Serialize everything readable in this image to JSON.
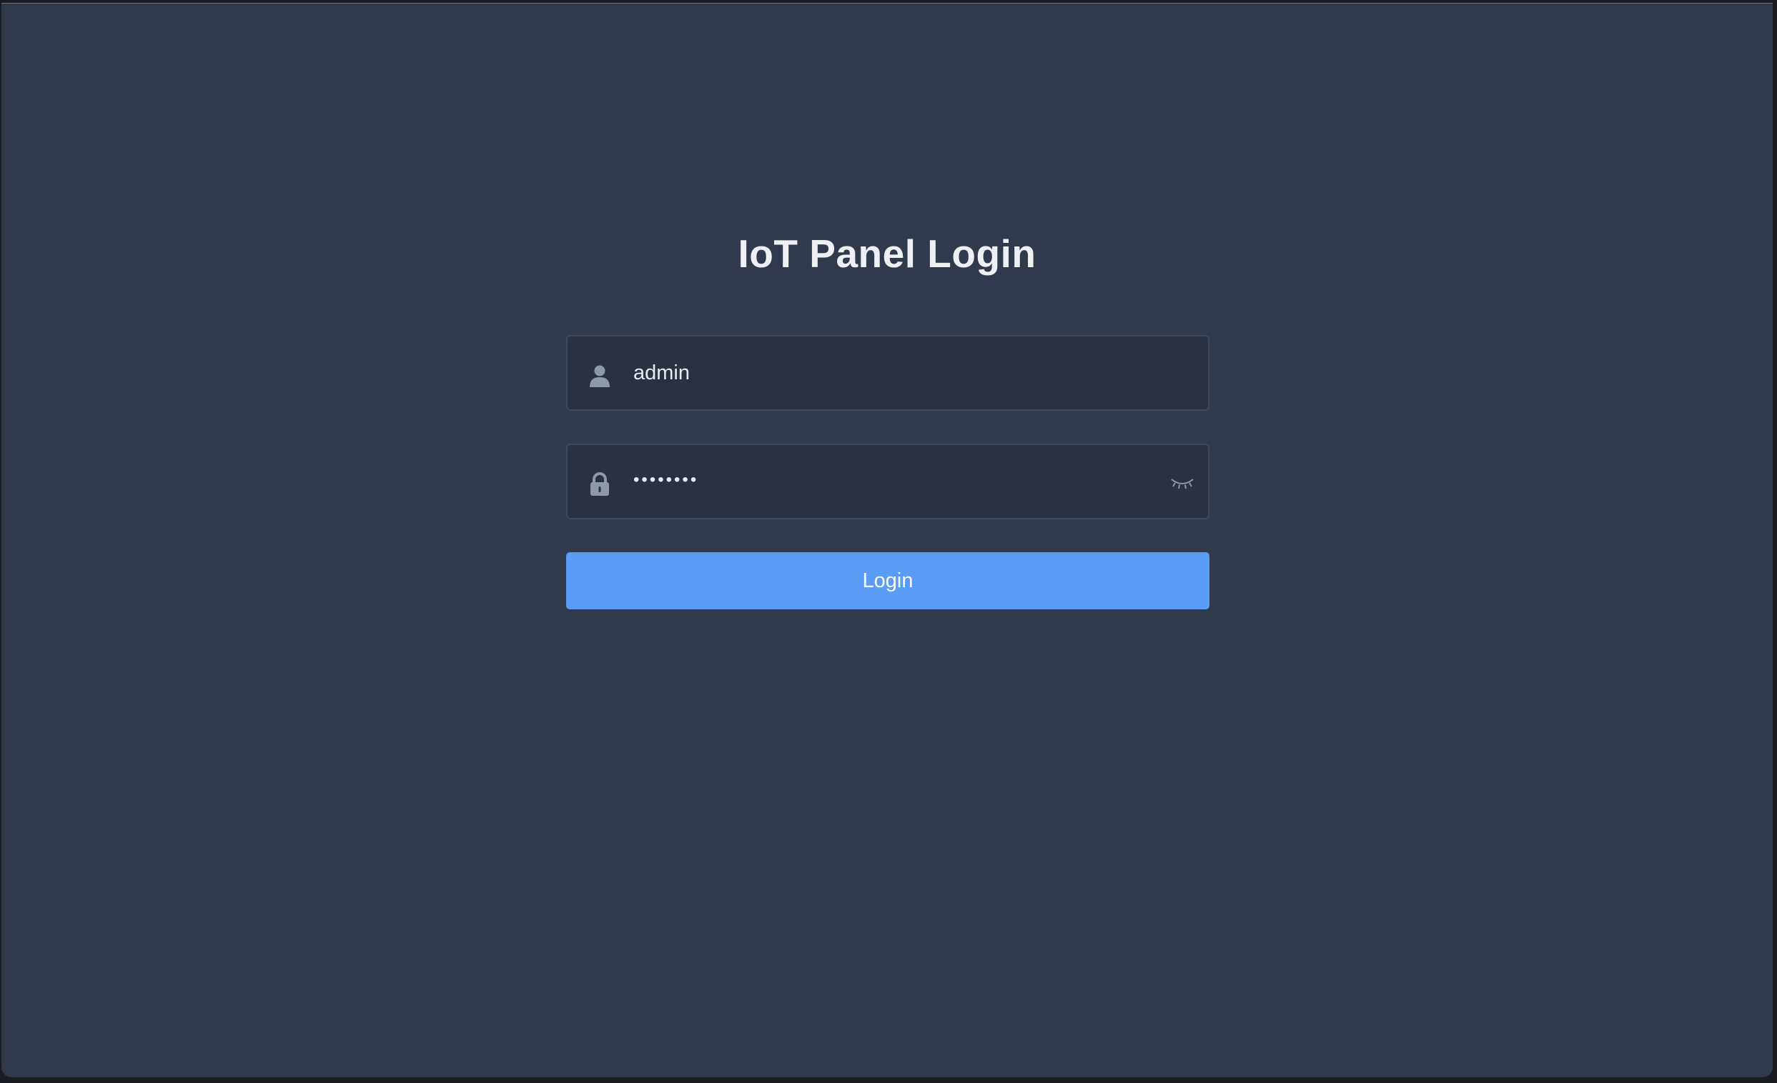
{
  "page": {
    "title": "IoT Panel Login"
  },
  "form": {
    "username": {
      "value": "admin",
      "icon": "user-icon"
    },
    "password": {
      "value": "••••••••",
      "icon": "lock-icon",
      "toggle_icon": "eye-closed-icon"
    },
    "login_label": "Login"
  },
  "colors": {
    "background": "#313a4c",
    "field_background": "#2a3242",
    "accent": "#5a9cf6",
    "title_text": "#eef0f3"
  }
}
